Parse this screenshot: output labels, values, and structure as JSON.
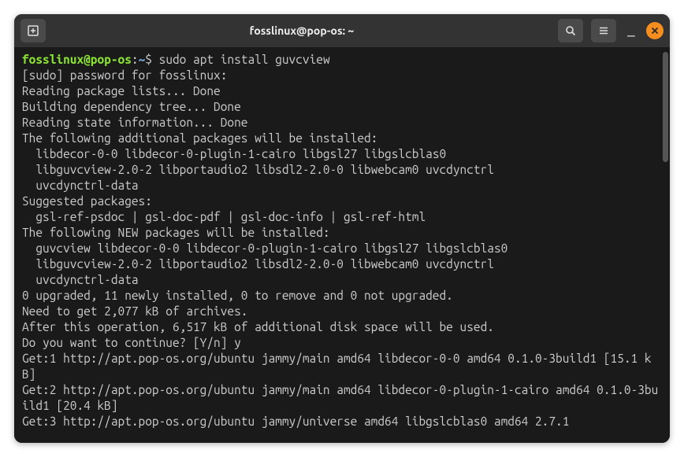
{
  "titlebar": {
    "title": "fosslinux@pop-os: ~"
  },
  "prompt": {
    "user_host": "fosslinux@pop-os",
    "separator": ":",
    "path": "~",
    "dollar": "$ ",
    "command": "sudo apt install guvcview"
  },
  "output": "[sudo] password for fosslinux:\nReading package lists... Done\nBuilding dependency tree... Done\nReading state information... Done\nThe following additional packages will be installed:\n  libdecor-0-0 libdecor-0-plugin-1-cairo libgsl27 libgslcblas0\n  libguvcview-2.0-2 libportaudio2 libsdl2-2.0-0 libwebcam0 uvcdynctrl\n  uvcdynctrl-data\nSuggested packages:\n  gsl-ref-psdoc | gsl-doc-pdf | gsl-doc-info | gsl-ref-html\nThe following NEW packages will be installed:\n  guvcview libdecor-0-0 libdecor-0-plugin-1-cairo libgsl27 libgslcblas0\n  libguvcview-2.0-2 libportaudio2 libsdl2-2.0-0 libwebcam0 uvcdynctrl\n  uvcdynctrl-data\n0 upgraded, 11 newly installed, 0 to remove and 0 not upgraded.\nNeed to get 2,077 kB of archives.\nAfter this operation, 6,517 kB of additional disk space will be used.\nDo you want to continue? [Y/n] y\nGet:1 http://apt.pop-os.org/ubuntu jammy/main amd64 libdecor-0-0 amd64 0.1.0-3build1 [15.1 kB]\nGet:2 http://apt.pop-os.org/ubuntu jammy/main amd64 libdecor-0-plugin-1-cairo amd64 0.1.0-3build1 [20.4 kB]\nGet:3 http://apt.pop-os.org/ubuntu jammy/universe amd64 libgslcblas0 amd64 2.7.1"
}
